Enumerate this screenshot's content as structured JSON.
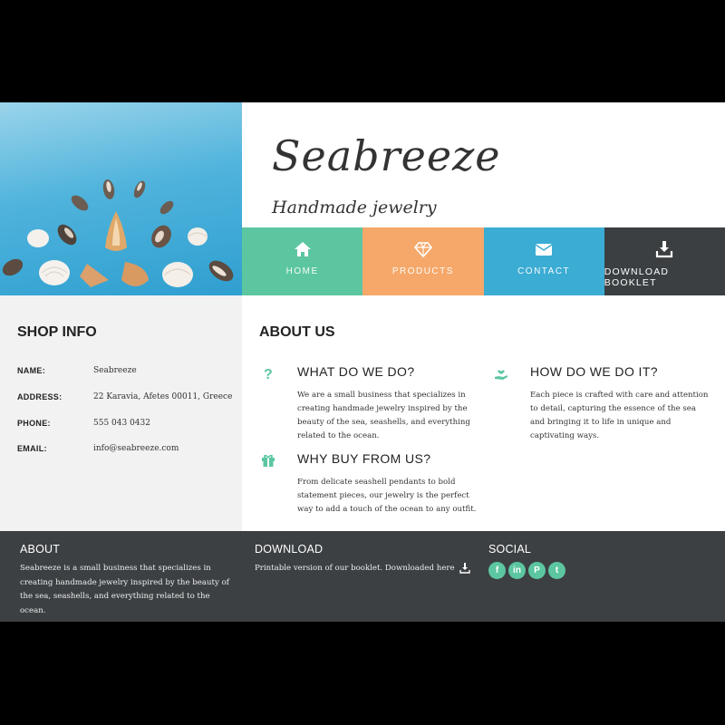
{
  "brand": {
    "title": "Seabreeze",
    "tagline": "Handmade jewelry"
  },
  "nav": {
    "items": [
      {
        "label": "HOME",
        "icon": "home-icon"
      },
      {
        "label": "PRODUCTS",
        "icon": "diamond-icon"
      },
      {
        "label": "CONTACT",
        "icon": "envelope-icon"
      },
      {
        "label": "DOWNLOAD BOOKLET",
        "icon": "download-icon"
      }
    ]
  },
  "shop_info": {
    "heading": "SHOP INFO",
    "rows": [
      {
        "key": "NAME:",
        "value": "Seabreeze"
      },
      {
        "key": "ADDRESS:",
        "value": "22 Karavia, Afetes 00011, Greece"
      },
      {
        "key": "PHONE:",
        "value": "555 043 0432"
      },
      {
        "key": "EMAIL:",
        "value": "info@seabreeze.com"
      }
    ]
  },
  "about_us": {
    "heading": "ABOUT US",
    "features": [
      {
        "icon": "question-icon",
        "title": "WHAT DO WE DO?",
        "text": "We are a small business that specializes in creating handmade jewelry inspired by the beauty of the sea, seashells, and everything related to the ocean."
      },
      {
        "icon": "heart-hand-icon",
        "title": "HOW DO WE DO IT?",
        "text": "Each piece is crafted with care and attention to detail, capturing the essence of the sea and bringing it to life in unique and captivating ways."
      },
      {
        "icon": "gift-icon",
        "title": "WHY BUY FROM US?",
        "text": "From delicate seashell pendants to bold statement pieces, our jewelry is the perfect way to add a touch of the ocean to any outfit."
      }
    ]
  },
  "footer": {
    "about": {
      "title": "ABOUT",
      "text": "Seabreeze is a small business that specializes in creating handmade jewelry inspired by the beauty of the sea, seashells, and everything related to the ocean."
    },
    "download": {
      "title": "DOWNLOAD",
      "text": "Printable version of our booklet. Downloaded here"
    },
    "social": {
      "title": "SOCIAL",
      "links": [
        {
          "name": "facebook-icon",
          "glyph": "f"
        },
        {
          "name": "linkedin-icon",
          "glyph": "in"
        },
        {
          "name": "pinterest-icon",
          "glyph": "P"
        },
        {
          "name": "twitter-icon",
          "glyph": "t"
        }
      ]
    }
  },
  "colors": {
    "green": "#5cc6a1",
    "orange": "#f5a86a",
    "blue": "#3bacd4",
    "dark": "#3b3f42",
    "footer": "#3c4043"
  }
}
